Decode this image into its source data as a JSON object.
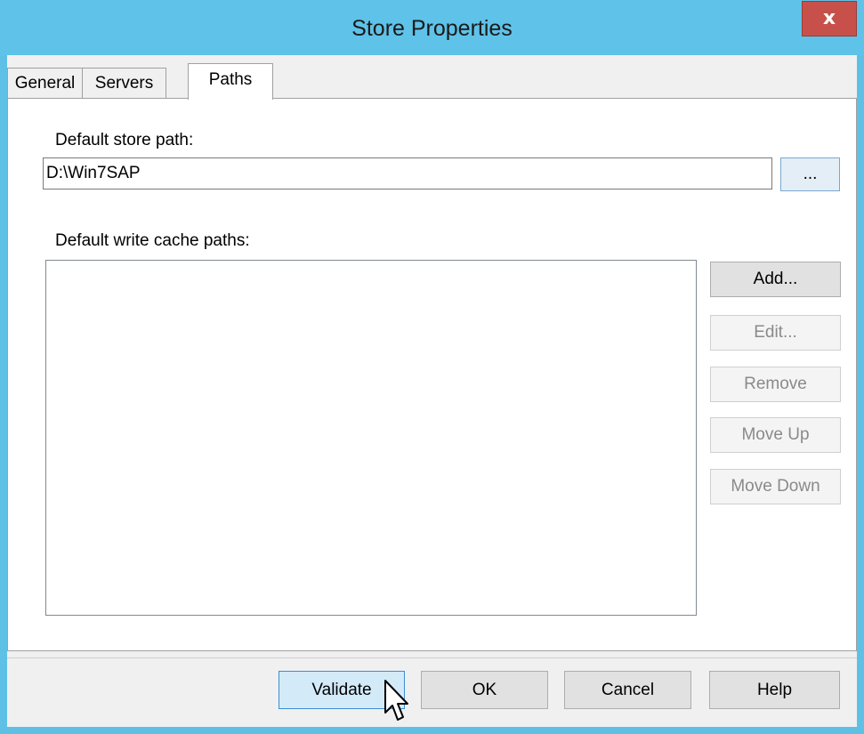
{
  "window": {
    "title": "Store Properties",
    "close_glyph": "x"
  },
  "tabs": [
    {
      "label": "General",
      "active": false
    },
    {
      "label": "Servers",
      "active": false
    },
    {
      "label": "Paths",
      "active": true
    }
  ],
  "paths": {
    "store_path_label": "Default store path:",
    "store_path_value": "D:\\Win7SAP",
    "browse_label": "...",
    "cache_paths_label": "Default write cache paths:",
    "cache_paths_items": [],
    "buttons": {
      "add": "Add...",
      "edit": "Edit...",
      "remove": "Remove",
      "move_up": "Move Up",
      "move_down": "Move Down"
    }
  },
  "footer": {
    "validate": "Validate",
    "ok": "OK",
    "cancel": "Cancel",
    "help": "Help"
  },
  "colors": {
    "titlebar": "#5fc2e8",
    "close_button": "#c7514a"
  },
  "icons": {
    "cursor": "mouse-pointer-icon"
  }
}
